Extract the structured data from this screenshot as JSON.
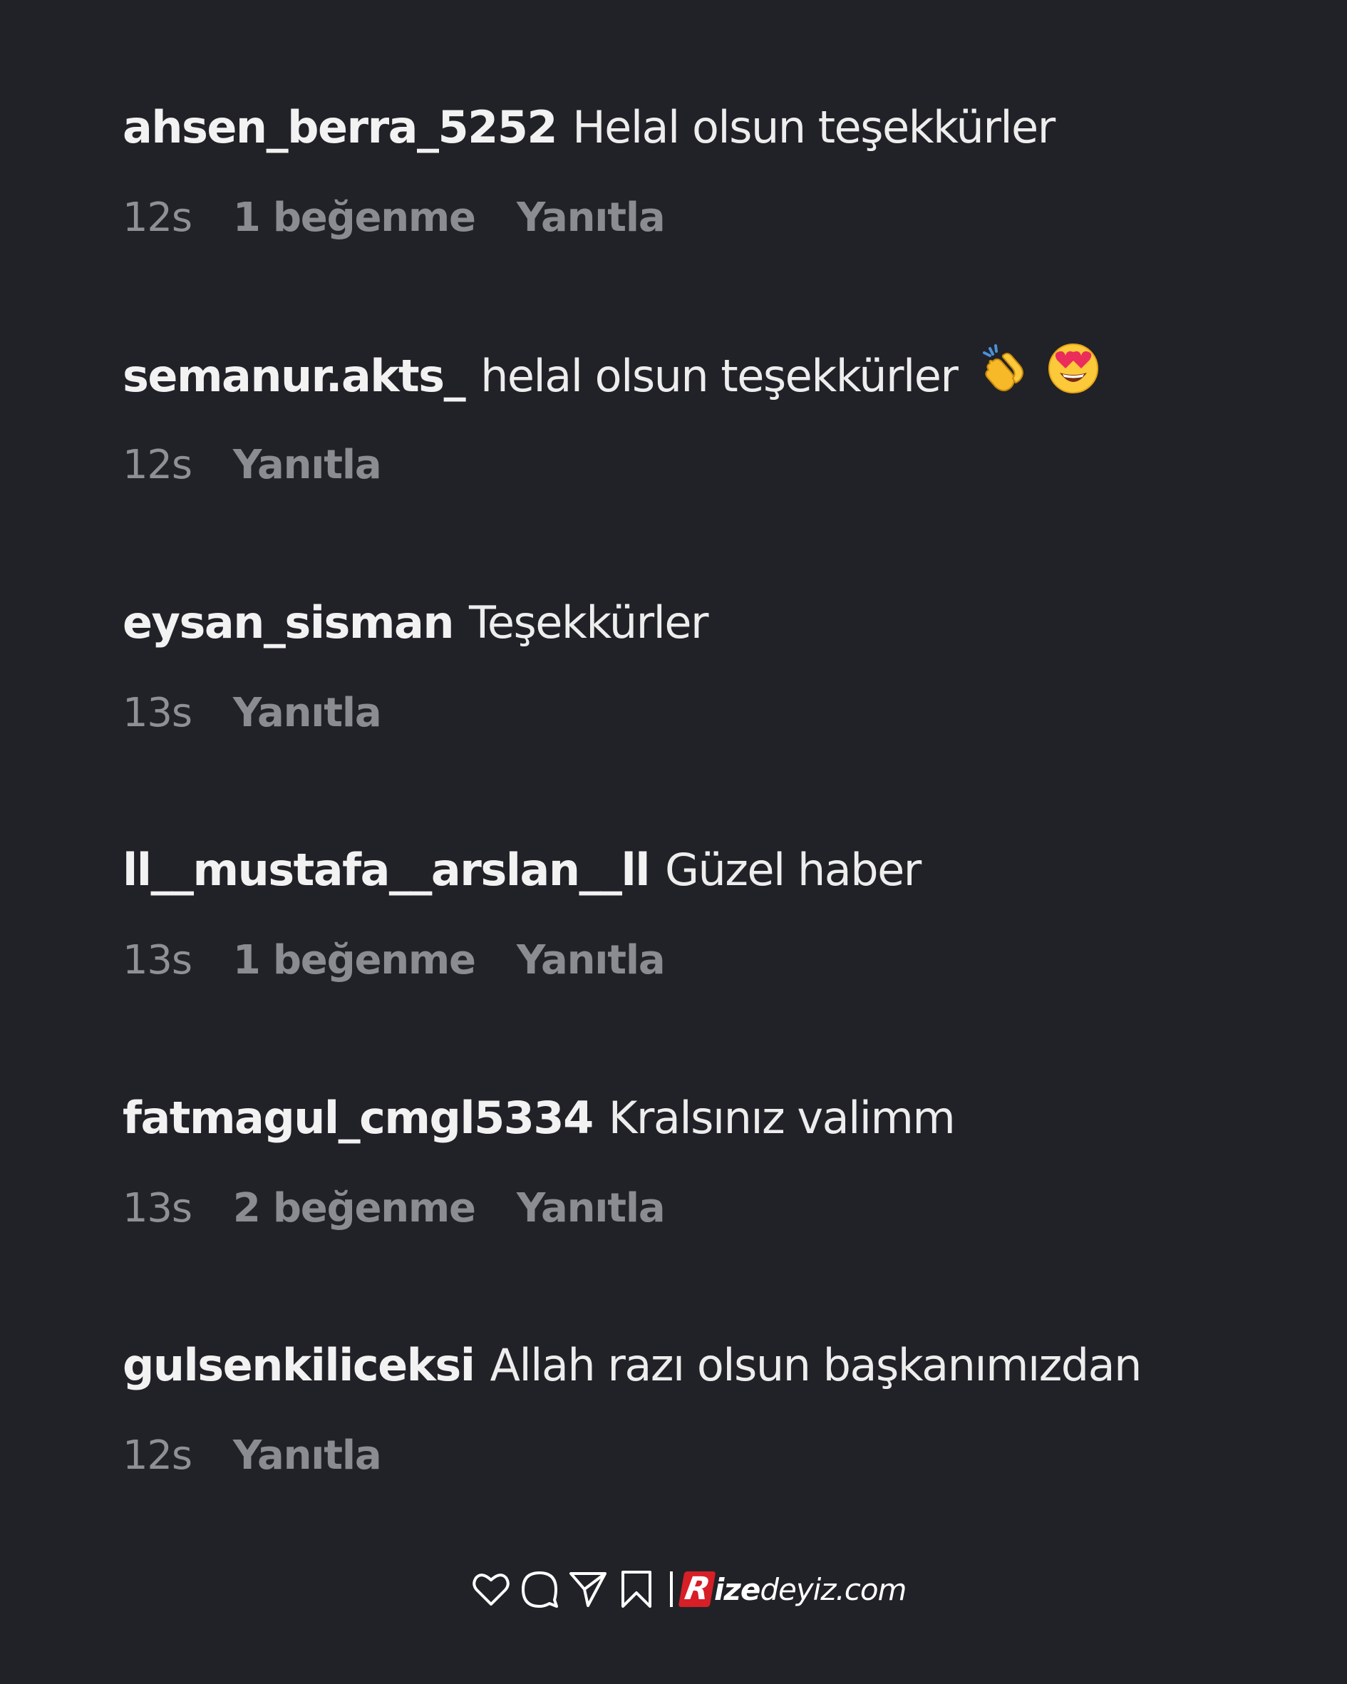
{
  "comments": [
    {
      "username": "ahsen_berra_5252",
      "text": "Helal olsun teşekkürler",
      "emojis": [],
      "time": "12s",
      "likes": "1 beğenme",
      "reply": "Yanıtla"
    },
    {
      "username": "semanur.akts_",
      "text": "helal olsun teşekkürler",
      "emojis": [
        "clapping-hands-emoji",
        "heart-eyes-emoji"
      ],
      "time": "12s",
      "likes": null,
      "reply": "Yanıtla"
    },
    {
      "username": "eysan_sisman",
      "text": "Teşekkürler",
      "emojis": [],
      "time": "13s",
      "likes": null,
      "reply": "Yanıtla"
    },
    {
      "username": "ll__mustafa__arslan__ll",
      "text": "Güzel haber",
      "emojis": [],
      "time": "13s",
      "likes": "1 beğenme",
      "reply": "Yanıtla"
    },
    {
      "username": "fatmagul_cmgl5334",
      "text": "Kralsınız valimm",
      "emojis": [],
      "time": "13s",
      "likes": "2 beğenme",
      "reply": "Yanıtla"
    },
    {
      "username": "gulsenkiliceksi",
      "text": "Allah razı olsun başkanımızdan",
      "emojis": [],
      "time": "12s",
      "likes": null,
      "reply": "Yanıtla"
    }
  ],
  "footer": {
    "icons": [
      "heart-icon",
      "comment-icon",
      "send-icon",
      "bookmark-icon"
    ],
    "brand_r": "R",
    "brand_ize": "ize",
    "brand_rest": "deyiz.com",
    "brand_accent": "#d61f26"
  },
  "colors": {
    "background": "#212227",
    "username": "#f2f2f2",
    "meta": "#8e9096"
  }
}
